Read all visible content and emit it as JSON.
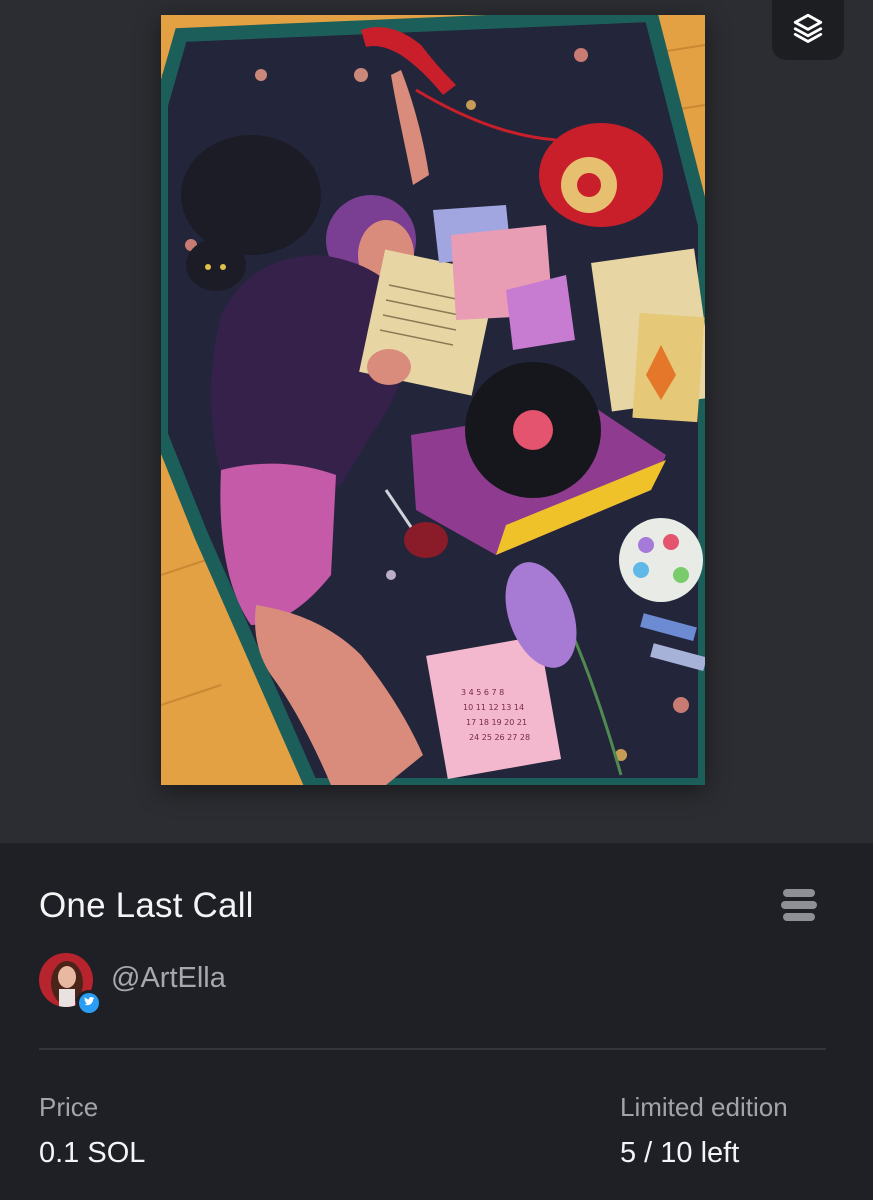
{
  "artwork": {
    "icon": "artwork-image",
    "colors": {
      "blanket": "#26283f",
      "rug": "#e8a640",
      "hoodie": "#35214a",
      "shorts": "#c45aa8",
      "phone": "#c91f2b",
      "record_player": "#8f3b90"
    }
  },
  "layers_button": {
    "icon": "layers-icon"
  },
  "nft": {
    "title": "One Last Call",
    "creator_handle": "@ArtElla",
    "creator_badge_icon": "twitter-icon",
    "menu_icon": "menu-icon"
  },
  "price": {
    "label": "Price",
    "value": "0.1 SOL"
  },
  "edition": {
    "label": "Limited edition",
    "value": "5 / 10 left"
  }
}
